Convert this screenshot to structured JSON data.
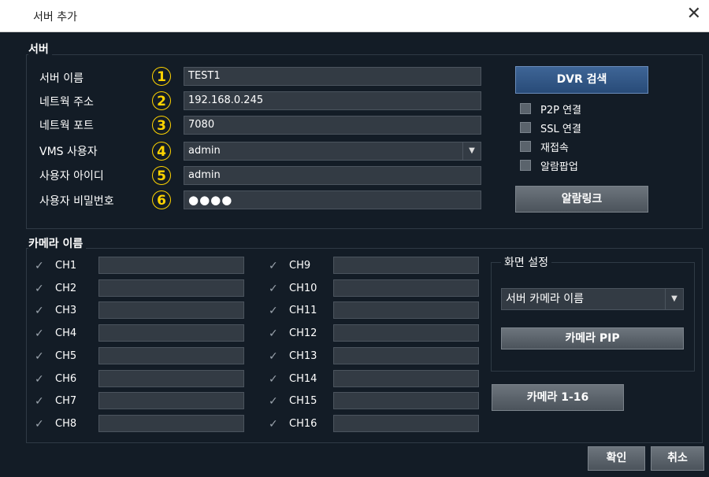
{
  "window": {
    "title": "서버 추가",
    "close_glyph": "✕"
  },
  "server_section": {
    "label": "서버",
    "fields": [
      {
        "label": "서버 이름",
        "num": "1",
        "value": "TEST1"
      },
      {
        "label": "네트웍 주소",
        "num": "2",
        "value": "192.168.0.245"
      },
      {
        "label": "네트웍 포트",
        "num": "3",
        "value": "7080"
      },
      {
        "label": "VMS 사용자",
        "num": "4",
        "value": "admin",
        "type": "dropdown"
      },
      {
        "label": "사용자 아이디",
        "num": "5",
        "value": "admin"
      },
      {
        "label": "사용자 비밀번호",
        "num": "6",
        "value": "●●●●",
        "type": "password"
      }
    ],
    "dvr_search_button": "DVR 검색",
    "options": [
      {
        "label": "P2P 연결",
        "checked": false
      },
      {
        "label": "SSL 연결",
        "checked": false
      },
      {
        "label": "재접속",
        "checked": false
      },
      {
        "label": "알람팝업",
        "checked": false
      }
    ],
    "alarm_link_button": "알람링크"
  },
  "camera_section": {
    "label": "카메라 이름",
    "tick_glyph": "✓",
    "channels_left": [
      "CH1",
      "CH2",
      "CH3",
      "CH4",
      "CH5",
      "CH6",
      "CH7",
      "CH8"
    ],
    "channels_right": [
      "CH9",
      "CH10",
      "CH11",
      "CH12",
      "CH13",
      "CH14",
      "CH15",
      "CH16"
    ],
    "screen_settings": {
      "label": "화면 설정",
      "dropdown_value": "서버 카메라 이름",
      "pip_button": "카메라 PIP"
    },
    "camera_range_button": "카메라 1-16"
  },
  "footer": {
    "ok_button": "확인",
    "cancel_button": "취소"
  },
  "colors": {
    "background": "#131c26",
    "accent": "#ffd400",
    "dvr_button": "#2f5585"
  }
}
